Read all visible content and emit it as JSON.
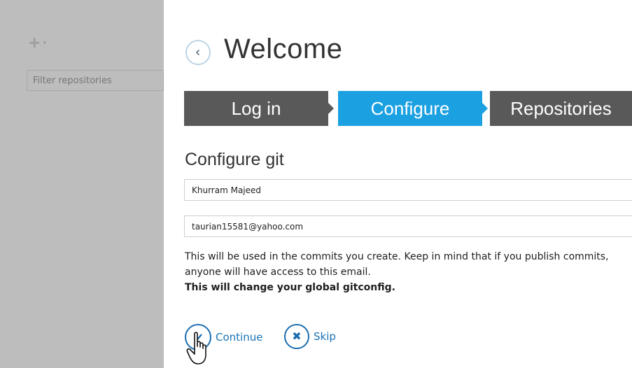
{
  "sidebar": {
    "add_icon": "plus-icon",
    "add_caret": "▾",
    "filter_placeholder": "Filter repositories"
  },
  "header": {
    "title": "Welcome",
    "back_icon": "chevron-left-icon"
  },
  "steps": [
    {
      "label": "Log in",
      "state": "done"
    },
    {
      "label": "Configure",
      "state": "active"
    },
    {
      "label": "Repositories",
      "state": "pending"
    }
  ],
  "configure": {
    "title": "Configure git",
    "name_value": "Khurram Majeed",
    "email_value": "taurian15581@yahoo.com",
    "help_text": "This will be used in the commits you create. Keep in mind that if you publish commits, anyone will have access to this email.",
    "help_bold": "This will change your global gitconfig."
  },
  "actions": {
    "continue_label": "Continue",
    "skip_label": "Skip"
  },
  "colors": {
    "accent": "#1ba1e2",
    "step_inactive": "#595959",
    "sidebar_bg": "#bdbdbd",
    "link": "#1a73b5"
  }
}
